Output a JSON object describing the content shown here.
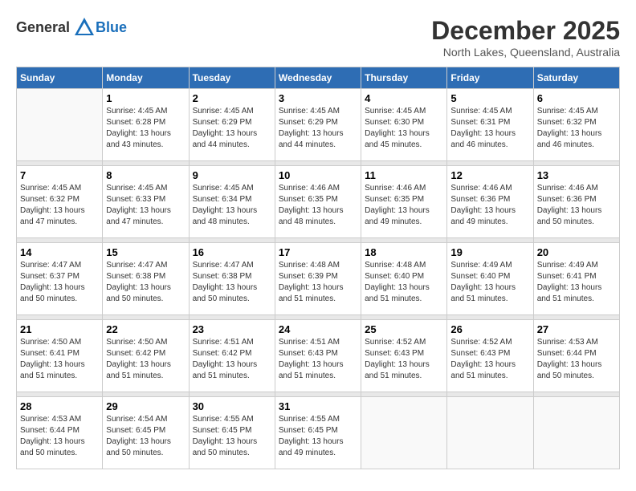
{
  "logo": {
    "general": "General",
    "blue": "Blue"
  },
  "title": {
    "month_year": "December 2025",
    "location": "North Lakes, Queensland, Australia"
  },
  "days_of_week": [
    "Sunday",
    "Monday",
    "Tuesday",
    "Wednesday",
    "Thursday",
    "Friday",
    "Saturday"
  ],
  "weeks": [
    [
      {
        "day": "",
        "info": ""
      },
      {
        "day": "1",
        "sunrise": "Sunrise: 4:45 AM",
        "sunset": "Sunset: 6:28 PM",
        "daylight": "Daylight: 13 hours and 43 minutes."
      },
      {
        "day": "2",
        "sunrise": "Sunrise: 4:45 AM",
        "sunset": "Sunset: 6:29 PM",
        "daylight": "Daylight: 13 hours and 44 minutes."
      },
      {
        "day": "3",
        "sunrise": "Sunrise: 4:45 AM",
        "sunset": "Sunset: 6:29 PM",
        "daylight": "Daylight: 13 hours and 44 minutes."
      },
      {
        "day": "4",
        "sunrise": "Sunrise: 4:45 AM",
        "sunset": "Sunset: 6:30 PM",
        "daylight": "Daylight: 13 hours and 45 minutes."
      },
      {
        "day": "5",
        "sunrise": "Sunrise: 4:45 AM",
        "sunset": "Sunset: 6:31 PM",
        "daylight": "Daylight: 13 hours and 46 minutes."
      },
      {
        "day": "6",
        "sunrise": "Sunrise: 4:45 AM",
        "sunset": "Sunset: 6:32 PM",
        "daylight": "Daylight: 13 hours and 46 minutes."
      }
    ],
    [
      {
        "day": "7",
        "sunrise": "Sunrise: 4:45 AM",
        "sunset": "Sunset: 6:32 PM",
        "daylight": "Daylight: 13 hours and 47 minutes."
      },
      {
        "day": "8",
        "sunrise": "Sunrise: 4:45 AM",
        "sunset": "Sunset: 6:33 PM",
        "daylight": "Daylight: 13 hours and 47 minutes."
      },
      {
        "day": "9",
        "sunrise": "Sunrise: 4:45 AM",
        "sunset": "Sunset: 6:34 PM",
        "daylight": "Daylight: 13 hours and 48 minutes."
      },
      {
        "day": "10",
        "sunrise": "Sunrise: 4:46 AM",
        "sunset": "Sunset: 6:35 PM",
        "daylight": "Daylight: 13 hours and 48 minutes."
      },
      {
        "day": "11",
        "sunrise": "Sunrise: 4:46 AM",
        "sunset": "Sunset: 6:35 PM",
        "daylight": "Daylight: 13 hours and 49 minutes."
      },
      {
        "day": "12",
        "sunrise": "Sunrise: 4:46 AM",
        "sunset": "Sunset: 6:36 PM",
        "daylight": "Daylight: 13 hours and 49 minutes."
      },
      {
        "day": "13",
        "sunrise": "Sunrise: 4:46 AM",
        "sunset": "Sunset: 6:36 PM",
        "daylight": "Daylight: 13 hours and 50 minutes."
      }
    ],
    [
      {
        "day": "14",
        "sunrise": "Sunrise: 4:47 AM",
        "sunset": "Sunset: 6:37 PM",
        "daylight": "Daylight: 13 hours and 50 minutes."
      },
      {
        "day": "15",
        "sunrise": "Sunrise: 4:47 AM",
        "sunset": "Sunset: 6:38 PM",
        "daylight": "Daylight: 13 hours and 50 minutes."
      },
      {
        "day": "16",
        "sunrise": "Sunrise: 4:47 AM",
        "sunset": "Sunset: 6:38 PM",
        "daylight": "Daylight: 13 hours and 50 minutes."
      },
      {
        "day": "17",
        "sunrise": "Sunrise: 4:48 AM",
        "sunset": "Sunset: 6:39 PM",
        "daylight": "Daylight: 13 hours and 51 minutes."
      },
      {
        "day": "18",
        "sunrise": "Sunrise: 4:48 AM",
        "sunset": "Sunset: 6:40 PM",
        "daylight": "Daylight: 13 hours and 51 minutes."
      },
      {
        "day": "19",
        "sunrise": "Sunrise: 4:49 AM",
        "sunset": "Sunset: 6:40 PM",
        "daylight": "Daylight: 13 hours and 51 minutes."
      },
      {
        "day": "20",
        "sunrise": "Sunrise: 4:49 AM",
        "sunset": "Sunset: 6:41 PM",
        "daylight": "Daylight: 13 hours and 51 minutes."
      }
    ],
    [
      {
        "day": "21",
        "sunrise": "Sunrise: 4:50 AM",
        "sunset": "Sunset: 6:41 PM",
        "daylight": "Daylight: 13 hours and 51 minutes."
      },
      {
        "day": "22",
        "sunrise": "Sunrise: 4:50 AM",
        "sunset": "Sunset: 6:42 PM",
        "daylight": "Daylight: 13 hours and 51 minutes."
      },
      {
        "day": "23",
        "sunrise": "Sunrise: 4:51 AM",
        "sunset": "Sunset: 6:42 PM",
        "daylight": "Daylight: 13 hours and 51 minutes."
      },
      {
        "day": "24",
        "sunrise": "Sunrise: 4:51 AM",
        "sunset": "Sunset: 6:43 PM",
        "daylight": "Daylight: 13 hours and 51 minutes."
      },
      {
        "day": "25",
        "sunrise": "Sunrise: 4:52 AM",
        "sunset": "Sunset: 6:43 PM",
        "daylight": "Daylight: 13 hours and 51 minutes."
      },
      {
        "day": "26",
        "sunrise": "Sunrise: 4:52 AM",
        "sunset": "Sunset: 6:43 PM",
        "daylight": "Daylight: 13 hours and 51 minutes."
      },
      {
        "day": "27",
        "sunrise": "Sunrise: 4:53 AM",
        "sunset": "Sunset: 6:44 PM",
        "daylight": "Daylight: 13 hours and 50 minutes."
      }
    ],
    [
      {
        "day": "28",
        "sunrise": "Sunrise: 4:53 AM",
        "sunset": "Sunset: 6:44 PM",
        "daylight": "Daylight: 13 hours and 50 minutes."
      },
      {
        "day": "29",
        "sunrise": "Sunrise: 4:54 AM",
        "sunset": "Sunset: 6:45 PM",
        "daylight": "Daylight: 13 hours and 50 minutes."
      },
      {
        "day": "30",
        "sunrise": "Sunrise: 4:55 AM",
        "sunset": "Sunset: 6:45 PM",
        "daylight": "Daylight: 13 hours and 50 minutes."
      },
      {
        "day": "31",
        "sunrise": "Sunrise: 4:55 AM",
        "sunset": "Sunset: 6:45 PM",
        "daylight": "Daylight: 13 hours and 49 minutes."
      },
      {
        "day": "",
        "info": ""
      },
      {
        "day": "",
        "info": ""
      },
      {
        "day": "",
        "info": ""
      }
    ]
  ]
}
